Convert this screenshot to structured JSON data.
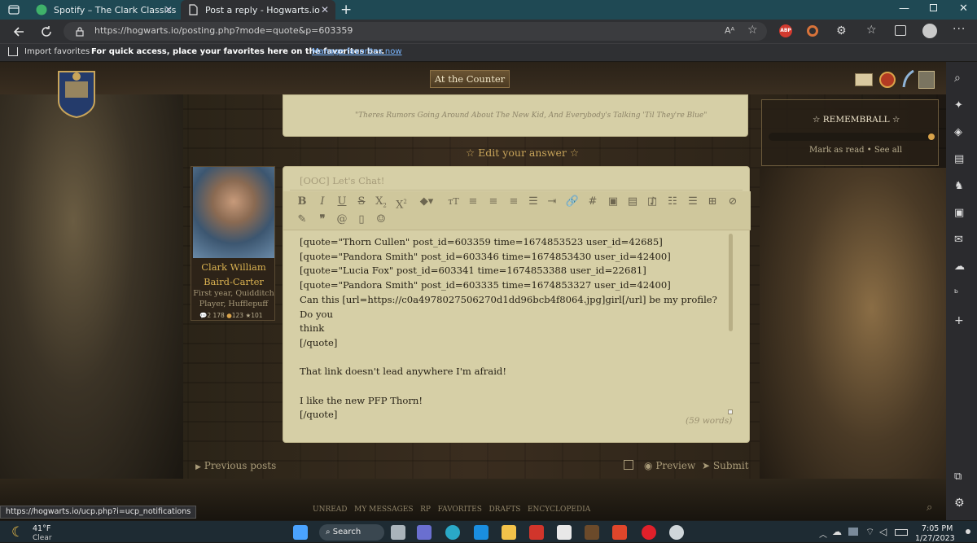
{
  "browser": {
    "tabs": [
      {
        "title": "Spotify – The Clark Classics",
        "active": false
      },
      {
        "title": "Post a reply - Hogwarts.io",
        "active": true
      }
    ],
    "url": "https://hogwarts.io/posting.php?mode=quote&p=603359",
    "favorites_bar": {
      "import_label": "Import favorites",
      "prompt": "For quick access, place your favorites here on the favorites bar.",
      "manage_link": "Manage favorites now"
    },
    "status_url": "https://hogwarts.io/ucp.php?i=ucp_notifications"
  },
  "site": {
    "banner": "At the Counter",
    "previous_post_quote": "\"Theres Rumors Going Around About The New Kid, And Everybody's Talking 'Til They're Blue\"",
    "section_title": "☆ Edit your answer ☆",
    "remembrall": {
      "title": "☆ REMEMBRALL ☆",
      "mark_read": "Mark as read",
      "separator": "•",
      "see_all": "See all"
    },
    "profile": {
      "name_line1": "Clark William",
      "name_line2": "Baird-Carter",
      "desc_line1": "First year, Quidditch",
      "desc_line2": "Player, Hufflepuff",
      "posts": "2 178",
      "points": "123",
      "stars": "101"
    },
    "editor": {
      "subject_placeholder": "[OOC] Let's Chat!",
      "lines": [
        "[quote=\"Thorn Cullen\" post_id=603359 time=1674853523 user_id=42685]",
        "[quote=\"Pandora Smith\" post_id=603346 time=1674853430 user_id=42400]",
        "[quote=\"Lucia Fox\" post_id=603341 time=1674853388 user_id=22681]",
        "[quote=\"Pandora Smith\" post_id=603335 time=1674853327 user_id=42400]",
        "Can this [url=https://c0a4978027506270d1dd96bcb4f8064.jpg]girl[/url] be my profile? Do you",
        "think",
        "[/quote]",
        "",
        "That link doesn't lead anywhere I'm afraid!",
        "",
        "I like the new PFP Thorn!",
        "[/quote]"
      ],
      "word_count": "(59 words)"
    },
    "actions": {
      "previous": "Previous posts",
      "preview": "Preview",
      "submit": "Submit"
    },
    "footer_nav": [
      "UNREAD",
      "MY MESSAGES",
      "RP",
      "FAVORITES",
      "DRAFTS",
      "ENCYCLOPEDIA"
    ]
  },
  "taskbar": {
    "weather_temp": "41°F",
    "weather_desc": "Clear",
    "search_label": "Search",
    "time": "7:05 PM",
    "date": "1/27/2023"
  },
  "colors": {
    "tabstrip": "#1f4954",
    "browser_chrome": "#2f3033",
    "parchment": "#d6cfa6",
    "gold_text": "#c9a55a",
    "link_blue": "#6fa8ff"
  }
}
